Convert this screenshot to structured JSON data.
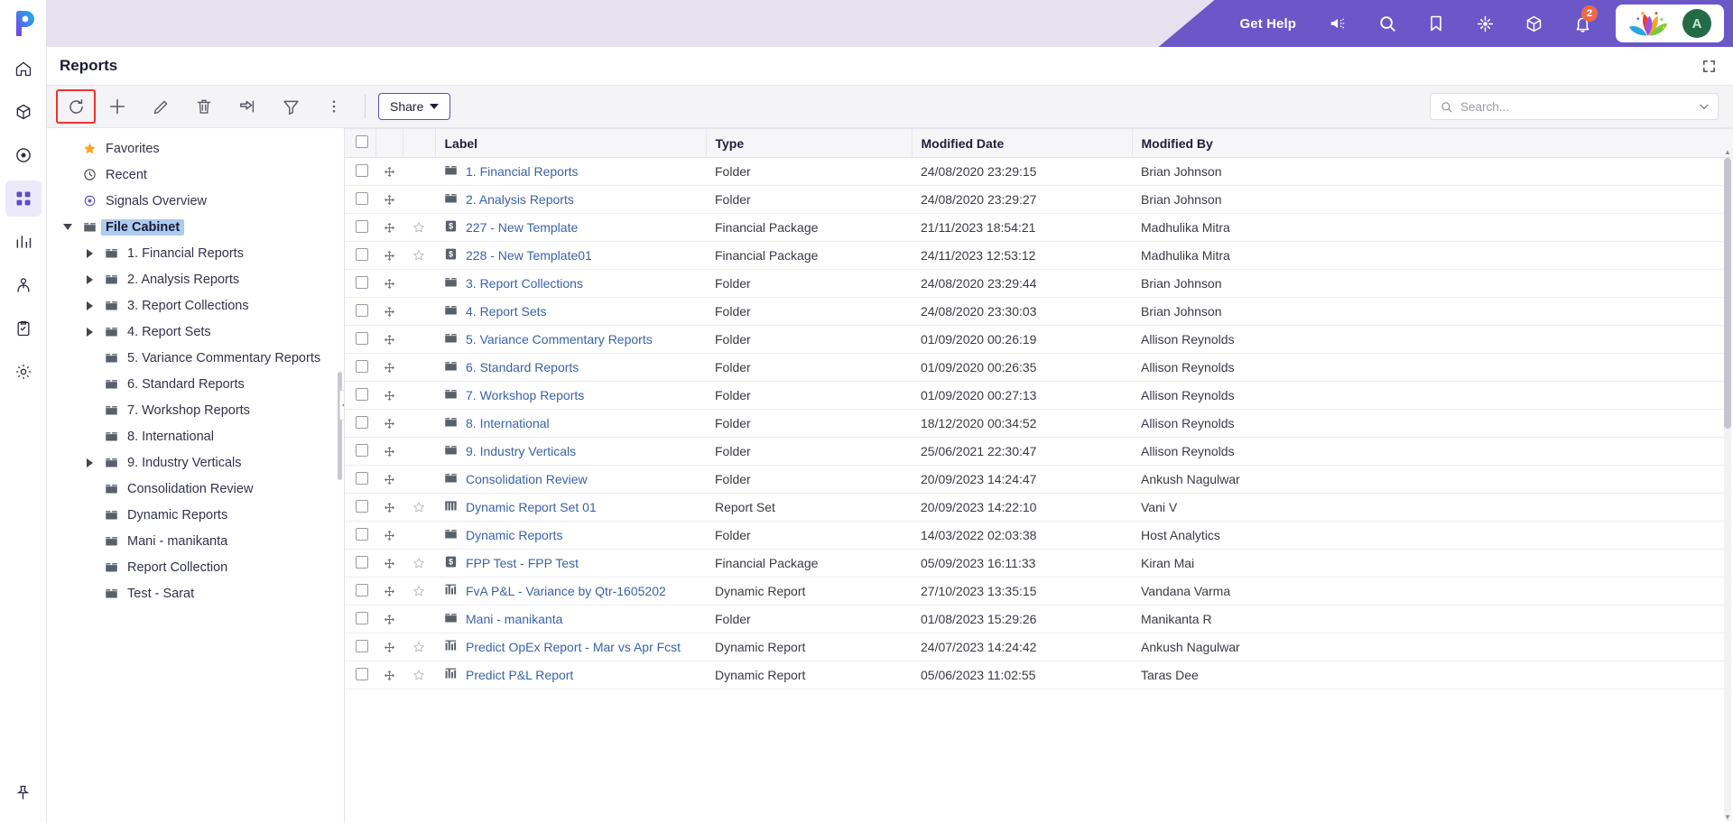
{
  "app": {
    "logo_name": "planful-logo",
    "brand_purple": "#6b57c8",
    "topbar_bg": "#e6e1ef"
  },
  "topbar": {
    "get_help": "Get Help",
    "icons": [
      {
        "name": "announcement-icon"
      },
      {
        "name": "search-icon"
      },
      {
        "name": "bookmark-icon"
      },
      {
        "name": "target-icon"
      },
      {
        "name": "package-icon"
      },
      {
        "name": "bell-icon"
      }
    ],
    "notification_count": "2",
    "avatar_initial": "A"
  },
  "page": {
    "title": "Reports",
    "expand_icon": "expand-icon"
  },
  "toolbar": {
    "tools": [
      {
        "name": "refresh-button",
        "label": "Refresh",
        "highlighted": true
      },
      {
        "name": "add-button",
        "label": "Add"
      },
      {
        "name": "edit-button",
        "label": "Edit"
      },
      {
        "name": "delete-button",
        "label": "Delete"
      },
      {
        "name": "move-button",
        "label": "Move"
      },
      {
        "name": "filter-button",
        "label": "Filter"
      },
      {
        "name": "more-button",
        "label": "More"
      }
    ],
    "share_label": "Share"
  },
  "search": {
    "value": "",
    "placeholder": "Search...",
    "icon": "search-icon",
    "dropdown_icon": "chevron-down-icon"
  },
  "sidebar": {
    "items": [
      {
        "label": "Favorites",
        "icon": "star-icon",
        "indent": 0,
        "twisty": "none",
        "selected": false
      },
      {
        "label": "Recent",
        "icon": "clock-icon",
        "indent": 0,
        "twisty": "none",
        "selected": false
      },
      {
        "label": "Signals Overview",
        "icon": "signal-icon",
        "indent": 0,
        "twisty": "none",
        "selected": false
      },
      {
        "label": "File Cabinet",
        "icon": "folder-icon",
        "indent": 0,
        "twisty": "down",
        "selected": true
      },
      {
        "label": "1. Financial Reports",
        "icon": "folder-icon",
        "indent": 1,
        "twisty": "right",
        "selected": false
      },
      {
        "label": "2. Analysis Reports",
        "icon": "folder-icon",
        "indent": 1,
        "twisty": "right",
        "selected": false
      },
      {
        "label": "3. Report Collections",
        "icon": "folder-icon",
        "indent": 1,
        "twisty": "right",
        "selected": false
      },
      {
        "label": "4. Report Sets",
        "icon": "folder-icon",
        "indent": 1,
        "twisty": "right",
        "selected": false
      },
      {
        "label": "5. Variance Commentary Reports",
        "icon": "folder-icon",
        "indent": 1,
        "twisty": "none",
        "selected": false
      },
      {
        "label": "6. Standard Reports",
        "icon": "folder-icon",
        "indent": 1,
        "twisty": "none",
        "selected": false
      },
      {
        "label": "7. Workshop Reports",
        "icon": "folder-icon",
        "indent": 1,
        "twisty": "none",
        "selected": false
      },
      {
        "label": "8. International",
        "icon": "folder-icon",
        "indent": 1,
        "twisty": "none",
        "selected": false
      },
      {
        "label": "9. Industry Verticals",
        "icon": "folder-icon",
        "indent": 1,
        "twisty": "right",
        "selected": false
      },
      {
        "label": "Consolidation Review",
        "icon": "folder-icon",
        "indent": 1,
        "twisty": "none",
        "selected": false
      },
      {
        "label": "Dynamic Reports",
        "icon": "folder-icon",
        "indent": 1,
        "twisty": "none",
        "selected": false
      },
      {
        "label": "Mani - manikanta",
        "icon": "folder-icon",
        "indent": 1,
        "twisty": "none",
        "selected": false
      },
      {
        "label": "Report Collection",
        "icon": "folder-icon",
        "indent": 1,
        "twisty": "none",
        "selected": false
      },
      {
        "label": "Test - Sarat",
        "icon": "folder-icon",
        "indent": 1,
        "twisty": "none",
        "selected": false
      }
    ]
  },
  "rail": {
    "items": [
      {
        "name": "sidebar-item-home",
        "icon": "home-icon"
      },
      {
        "name": "sidebar-item-modeling",
        "icon": "cube-icon"
      },
      {
        "name": "sidebar-item-signals",
        "icon": "signal-icon"
      },
      {
        "name": "sidebar-item-apps",
        "icon": "grid-icon",
        "active": true
      },
      {
        "name": "sidebar-item-reports",
        "icon": "chart-icon"
      },
      {
        "name": "sidebar-item-people",
        "icon": "person-icon"
      },
      {
        "name": "sidebar-item-tasks",
        "icon": "clipboard-icon"
      },
      {
        "name": "sidebar-item-settings",
        "icon": "gear-icon"
      }
    ],
    "pin_icon": "pin-icon"
  },
  "table": {
    "columns": [
      "Label",
      "Type",
      "Modified Date",
      "Modified By"
    ],
    "rows": [
      {
        "label": "1. Financial Reports",
        "icon": "folder-icon",
        "star": false,
        "type": "Folder",
        "date": "24/08/2020 23:29:15",
        "by": "Brian Johnson"
      },
      {
        "label": "2. Analysis Reports",
        "icon": "folder-icon",
        "star": false,
        "type": "Folder",
        "date": "24/08/2020 23:29:27",
        "by": "Brian Johnson"
      },
      {
        "label": "227 - New Template",
        "icon": "financial-pkg-icon",
        "star": true,
        "type": "Financial Package",
        "date": "21/11/2023 18:54:21",
        "by": "Madhulika Mitra"
      },
      {
        "label": "228 - New Template01",
        "icon": "financial-pkg-icon",
        "star": true,
        "type": "Financial Package",
        "date": "24/11/2023 12:53:12",
        "by": "Madhulika Mitra"
      },
      {
        "label": "3. Report Collections",
        "icon": "folder-icon",
        "star": false,
        "type": "Folder",
        "date": "24/08/2020 23:29:44",
        "by": "Brian Johnson"
      },
      {
        "label": "4. Report Sets",
        "icon": "folder-icon",
        "star": false,
        "type": "Folder",
        "date": "24/08/2020 23:30:03",
        "by": "Brian Johnson"
      },
      {
        "label": "5. Variance Commentary Reports",
        "icon": "folder-icon",
        "star": false,
        "type": "Folder",
        "date": "01/09/2020 00:26:19",
        "by": "Allison Reynolds"
      },
      {
        "label": "6. Standard Reports",
        "icon": "folder-icon",
        "star": false,
        "type": "Folder",
        "date": "01/09/2020 00:26:35",
        "by": "Allison Reynolds"
      },
      {
        "label": "7. Workshop Reports",
        "icon": "folder-icon",
        "star": false,
        "type": "Folder",
        "date": "01/09/2020 00:27:13",
        "by": "Allison Reynolds"
      },
      {
        "label": "8. International",
        "icon": "folder-icon",
        "star": false,
        "type": "Folder",
        "date": "18/12/2020 00:34:52",
        "by": "Allison Reynolds"
      },
      {
        "label": "9. Industry Verticals",
        "icon": "folder-icon",
        "star": false,
        "type": "Folder",
        "date": "25/06/2021 22:30:47",
        "by": "Allison Reynolds"
      },
      {
        "label": "Consolidation Review",
        "icon": "folder-icon",
        "star": false,
        "type": "Folder",
        "date": "20/09/2023 14:24:47",
        "by": "Ankush Nagulwar"
      },
      {
        "label": "Dynamic Report Set 01",
        "icon": "report-set-icon",
        "star": true,
        "type": "Report Set",
        "date": "20/09/2023 14:22:10",
        "by": "Vani V"
      },
      {
        "label": "Dynamic Reports",
        "icon": "folder-icon",
        "star": false,
        "type": "Folder",
        "date": "14/03/2022 02:03:38",
        "by": "Host Analytics"
      },
      {
        "label": "FPP Test - FPP Test",
        "icon": "financial-pkg-icon",
        "star": true,
        "type": "Financial Package",
        "date": "05/09/2023 16:11:33",
        "by": "Kiran Mai"
      },
      {
        "label": "FvA P&L - Variance by Qtr-1605202",
        "icon": "dynamic-report-icon",
        "star": true,
        "type": "Dynamic Report",
        "date": "27/10/2023 13:35:15",
        "by": "Vandana Varma"
      },
      {
        "label": "Mani - manikanta",
        "icon": "folder-icon",
        "star": false,
        "type": "Folder",
        "date": "01/08/2023 15:29:26",
        "by": "Manikanta R"
      },
      {
        "label": "Predict OpEx Report - Mar vs Apr Fcst",
        "icon": "dynamic-report-icon",
        "star": true,
        "type": "Dynamic Report",
        "date": "24/07/2023 14:24:42",
        "by": "Ankush Nagulwar"
      },
      {
        "label": "Predict P&L Report",
        "icon": "dynamic-report-icon",
        "star": true,
        "type": "Dynamic Report",
        "date": "05/06/2023 11:02:55",
        "by": "Taras Dee"
      }
    ]
  }
}
